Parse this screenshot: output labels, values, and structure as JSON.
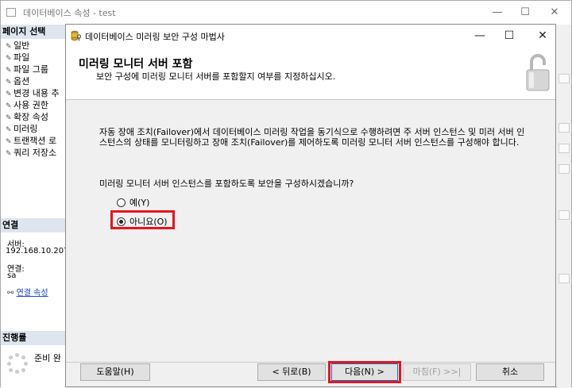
{
  "bg_window": {
    "title": "데이터베이스 속성 - test",
    "controls": [
      "—",
      "☐",
      "✕"
    ]
  },
  "bg_left": {
    "select_page_header": "페이지 선택",
    "pages": [
      "일반",
      "파일",
      "파일 그룹",
      "옵션",
      "변경 내용 추",
      "사용 권한",
      "확장 속성",
      "미러링",
      "트랜잭션 로",
      "쿼리 저장소"
    ],
    "connection_header": "연결",
    "server_label": "서버:",
    "server_value": "192.168.10.207",
    "connection_label": "연결:",
    "connection_value": "sa",
    "connection_props_link": "연결 속성",
    "progress_header": "진행률",
    "progress_status": "준비 완"
  },
  "dialog": {
    "title": "데이터베이스 미러링 보안 구성 마법사",
    "controls": [
      "—",
      "☐",
      "✕"
    ],
    "header_title": "미러링 모니터 서버 포함",
    "header_subtitle": "보안 구성에 미러링 모니터 서버를 포함할지 여부를 지정하십시오.",
    "description": "자동 장애 조치(Failover)에서 데이터베이스 미러링 작업을 동기식으로 수행하려면 주 서버 인스턴스 및 미러 서버 인스턴스의 상태를 모니터링하고 장애 조치(Failover)를 제어하도록 미러링 모니터 서버 인스턴스를 구성해야 합니다.",
    "question": "미러링 모니터 서버 인스턴스를 포함하도록 보안을 구성하시겠습니까?",
    "options": [
      {
        "label": "예(Y)",
        "selected": false
      },
      {
        "label": "아니요(O)",
        "selected": true
      }
    ],
    "buttons": {
      "help": "도움말(H)",
      "back": "< 뒤로(B)",
      "next": "다음(N) >",
      "finish": "마침(F) >>|",
      "cancel": "취소"
    }
  },
  "colors": {
    "highlight": "#e8141c",
    "link": "#1a43c8",
    "section_header": "#dfe5ef"
  }
}
